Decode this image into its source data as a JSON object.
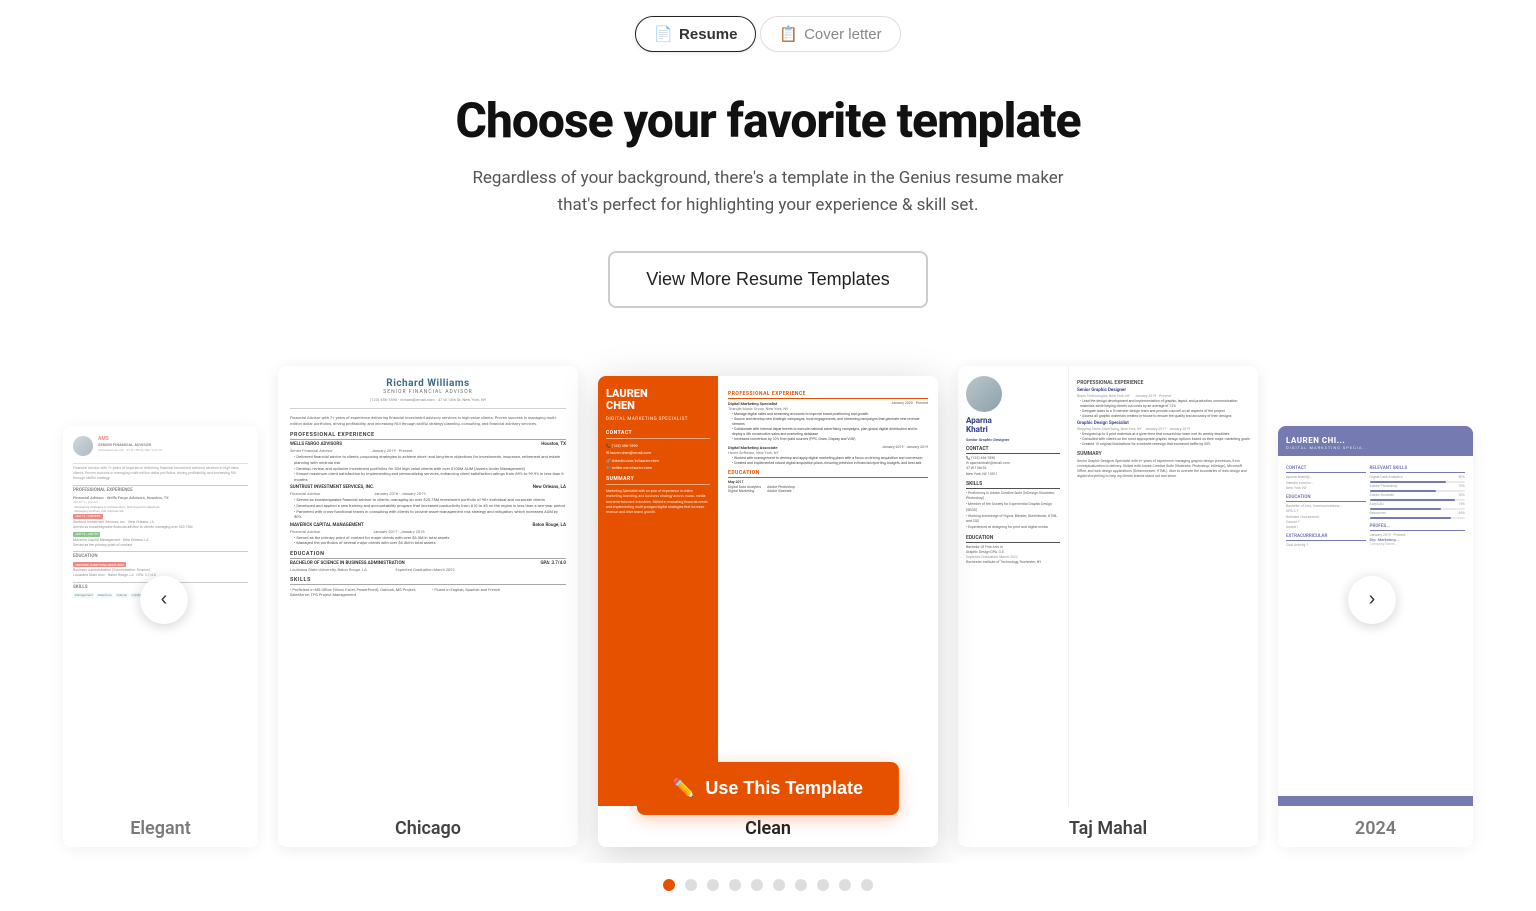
{
  "tabs": [
    {
      "id": "resume",
      "label": "Resume",
      "active": true,
      "icon": "📄"
    },
    {
      "id": "cover-letter",
      "label": "Cover letter",
      "active": false,
      "icon": "📋"
    }
  ],
  "hero": {
    "title": "Choose your favorite template",
    "subtitle": "Regardless of your background, there's a template in the Genius resume maker that's perfect for highlighting your experience & skill set.",
    "viewMoreBtn": "View More Resume Templates"
  },
  "templates": [
    {
      "id": "elegant",
      "name": "Elegant",
      "position": "far-left"
    },
    {
      "id": "chicago",
      "name": "Chicago",
      "position": "left"
    },
    {
      "id": "clean",
      "name": "Clean",
      "position": "center"
    },
    {
      "id": "tajmahal",
      "name": "Taj Mahal",
      "position": "right"
    },
    {
      "id": "2024",
      "name": "2024",
      "position": "far-right"
    }
  ],
  "useTemplateBtn": "Use This Template",
  "carouselNav": {
    "left": "‹",
    "right": "›"
  },
  "dots": {
    "total": 10,
    "active": 0
  },
  "chicago": {
    "name": "Richard Williams",
    "title": "SENIOR FINANCIAL ADVISOR",
    "contact": "(123) 456-7890 · richard@email.com · 47 W 13th St, New York, NY",
    "summary": "Financial Advisor with 7+ years of experience delivering financial investment advisory services in high-value clients. Proven success in managing multi-million dollar portfolios, driving profitability, and increasing ROI through skillful strategy planning, consulting, and financial advisory services.",
    "experience_title": "PROFESSIONAL EXPERIENCE",
    "jobs": [
      {
        "company": "WELLS FARGO ADVISORS",
        "location": "Houston, TX",
        "role": "Senior Financial Advisor",
        "dates": "January 2019 - Present",
        "bullets": [
          "Delivered financial advice to clients, proposing strategies to achieve short- and long-term objectives for investments, insurance, retirement and estate planning with minimal risk",
          "Develop, review, and optimize investment portfolios for 304 high-value clients with over $100M AUM"
        ]
      },
      {
        "company": "SUNTRUST INVESTMENT SERVICES, INC.",
        "location": "New Orleans, LA",
        "role": "Financial Advisor",
        "dates": "January 2016 - January 2019",
        "bullets": [
          "Served as knowledgeable financial advisor to clients, managing an over $20.75M investment portfolio of 90+ individual and corporate clients",
          "Developed and applied a new training and accountability program that increased productivity from #10 to #3 on the region in less than a two-year period"
        ]
      },
      {
        "company": "MAVERICK CAPITAL MANAGEMENT",
        "location": "Baton Rouge, LA",
        "role": "Financial Advisor",
        "dates": "January 2017 - January 2018",
        "bullets": [
          "Served as the primary point of contact for major clients with over $6.3M in total assets",
          "Managed the portfolio of several major clients with over $6.3M in total assets"
        ]
      }
    ],
    "education_title": "EDUCATION",
    "education": {
      "degree": "BACHELOR OF SCIENCE IN BUSINESS ADMINISTRATION",
      "gpa": "GPA: 3.7/4.0",
      "school": "Louisiana State University, Baton Rouge, LA",
      "date": "Expected Graduation March 2022"
    },
    "skills_title": "SKILLS",
    "skills": [
      "Proficient in MS Office (Word, Excel, PowerPoint), Outlook, MS Project, Salesforce, TPS Project Management",
      "Fluent in English, Spanish and French"
    ]
  },
  "clean": {
    "name": "LAUREN\nCHEN",
    "title": "DIGITAL MARKETING SPECIALIST",
    "contact_section": "CONTACT",
    "contacts": [
      "(123) 456-7890",
      "lauren.chen@email.com",
      "linkedin.com/in/lauren-chen",
      "twitter.com/lauren-chen"
    ],
    "summary_section": "SUMMARY",
    "summary": "Marketing Specialist with an year of experience in online marketing, branding, and business strategy across music, media and entertainment industries. Skilled in evaluating financial needs and implementing multi-pronged digital strategies that increase revenue and drive brand growth.",
    "experience_section": "PROFESSIONAL EXPERIENCE",
    "jobs": [
      {
        "role": "Digital Marketing Specialist",
        "company": "Triangle Music Group, New York, NY",
        "dates": "January 2020 - Present",
        "bullets": [
          "Manage digital sales and streaming accounts to improve brand positioning and growth",
          "Source and develop new strategic campaigns, local engagements, and streaming campaigns that generate new revenue streams",
          "Collaborate with internal departments to execute national advertising campaigns, plan global digital distribution and to deploy a 4th consecutive sales and marketing database"
        ]
      },
      {
        "role": "Digital Marketing Associate",
        "company": "Home Software, New York, NY",
        "dates": "January 2019 - January 2019",
        "bullets": [
          "Worked with management to develop and apply digital marketing plans with a focus on driving acquisition and conversion",
          "Created and implemented robust digital acquisition plans, ensuring precision in financial reporting, budgets, and best ads"
        ]
      }
    ],
    "education_section": "EDUCATION",
    "education": {
      "degree": "Digital Data Analytics",
      "school": "May 2017"
    }
  },
  "tajmahal": {
    "name": "Aparna\nKhatri",
    "title": "Senior Graphic Designer",
    "experience_section": "PROFESSIONAL EXPERIENCE",
    "jobs": [
      {
        "role": "Senior Graphic Designer",
        "company": "Bepin Technologies, New York, NY",
        "dates": "January 2019 - Present",
        "bullets": [
          "Lead the design development and implementation of graphic, layout, and production communication materials while helping clients cut costs by an average of 12%",
          "Delegate tasks to a 5-member design team and provide counsel on all aspects of the project"
        ]
      },
      {
        "role": "Graphic Design Specialist",
        "company": "Stepping Stone Advertising, New York, NY",
        "dates": "January 2017 - January 2019",
        "bullets": [
          "Designed up to 5 print materials at a given time that ensured our team met its weekly deadlines",
          "Consulted with clients on the most appropriate graphic design options based on their major marketing goals"
        ]
      }
    ],
    "summary_section": "SUMMARY",
    "summary": "Senior Graphic Designer Specialist with 6+ years of experience managing graphic design processes, from conceptualization to delivery. Skilled with Adobe Creative Suite (Illustrator, Photoshop, InDesign), Microsoft Office, and web design applications (Dreamweaver, HTML). Able to oversee the boundaries of web design and digital storytelling to help my clients brands stand out and shine.",
    "skills_section": "SKILLS",
    "skills": [
      "Proficiency in Adobe Creative Suite (InDesign, Illustrator, Photoshop)",
      "Member of the Society for Experiential Graphic Design (SEGD)",
      "Working knowledge of Figma, Blender, Sketchbook, HTML and CSS",
      "Experienced at designing for print and digital media"
    ],
    "education_section": "EDUCATION",
    "education": {
      "degree": "Bachelor of Fine Arts in Graphic Design GPA: 3.5",
      "school": "Rochester Institute of Technology, Rochester, NY",
      "date": "Expected Graduation March 2022"
    }
  }
}
